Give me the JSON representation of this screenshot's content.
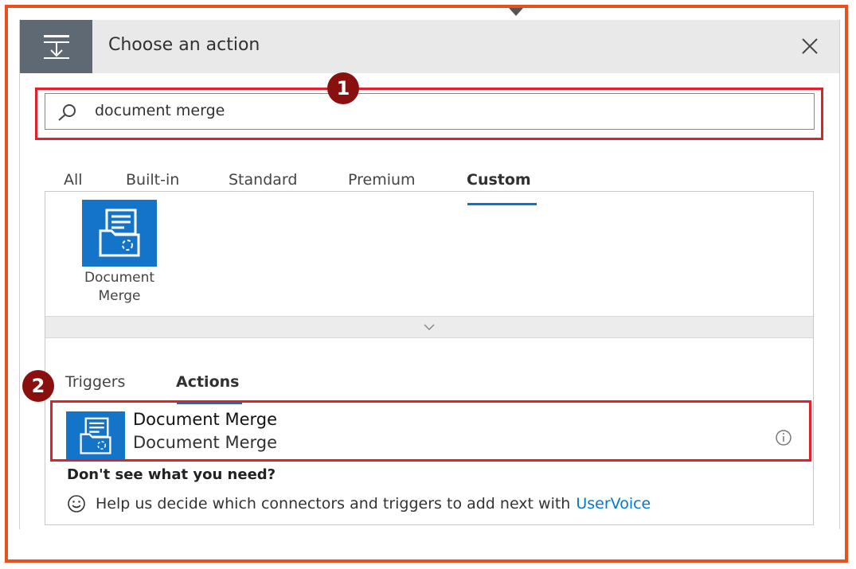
{
  "dialog": {
    "title": "Choose an action",
    "close_icon": "close-icon",
    "header_icon": "action-step-icon"
  },
  "search": {
    "value": "document merge",
    "icon": "search-icon"
  },
  "annotations": {
    "badge_1": "1",
    "badge_2": "2",
    "highlight_color": "#e0202a",
    "badge_color": "#8a1010"
  },
  "tabs": [
    {
      "label": "All"
    },
    {
      "label": "Built-in"
    },
    {
      "label": "Standard"
    },
    {
      "label": "Premium"
    },
    {
      "label": "Custom",
      "active": true
    }
  ],
  "connector": {
    "label_line1": "Document",
    "label_line2": "Merge",
    "icon": "document-merge-icon",
    "color": "#1475c8"
  },
  "sub_tabs": [
    {
      "label": "Triggers"
    },
    {
      "label": "Actions",
      "active": true
    }
  ],
  "action": {
    "title": "Document Merge",
    "subtitle": "Document Merge",
    "info_icon": "info-icon"
  },
  "help": {
    "heading": "Don't see what you need?",
    "text": "Help us decide which connectors and triggers to add next with",
    "link": "UserVoice",
    "icon": "smiley-icon"
  },
  "colors": {
    "accent": "#0078d4",
    "frame": "#e8501f"
  }
}
